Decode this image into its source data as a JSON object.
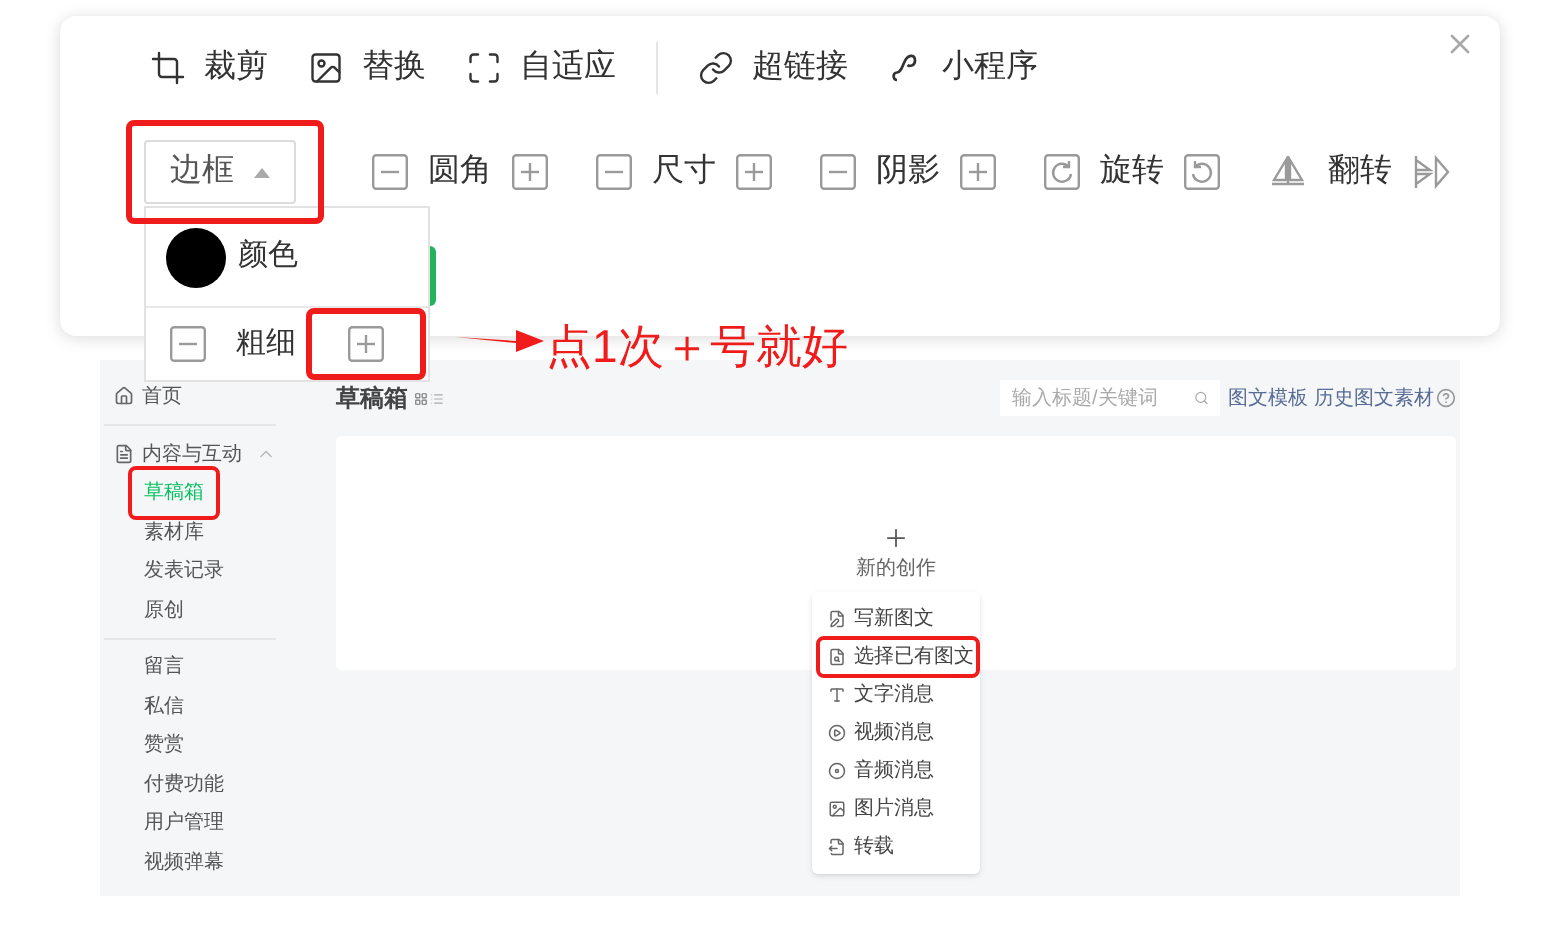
{
  "toolbar": {
    "actions": [
      {
        "kind": "crop",
        "label": "裁剪"
      },
      {
        "kind": "image",
        "label": "替换"
      },
      {
        "kind": "fit",
        "label": "自适应"
      },
      {
        "kind": "link",
        "label": "超链接"
      },
      {
        "kind": "miniprogram",
        "label": "小程序"
      }
    ],
    "controls": [
      {
        "kind": "dropdown",
        "label": "边框",
        "expanded": true,
        "highlighted": true
      },
      {
        "kind": "stepper",
        "label": "圆角",
        "highlighted": false
      },
      {
        "kind": "stepper",
        "label": "尺寸",
        "highlighted": false
      },
      {
        "kind": "stepper",
        "label": "阴影",
        "highlighted": false
      },
      {
        "kind": "rotate",
        "label": "旋转",
        "highlighted": false
      },
      {
        "kind": "flip",
        "label": "翻转",
        "highlighted": false
      }
    ]
  },
  "border_menu": {
    "items": [
      {
        "kind": "color",
        "label": "颜色",
        "color": "#000000",
        "highlighted": false
      },
      {
        "kind": "stepper",
        "label": "粗细",
        "highlighted": true
      }
    ]
  },
  "annotation": {
    "text": "点1次＋号就好"
  },
  "screenshot": {
    "sidebar": {
      "items": [
        {
          "kind": "home",
          "label": "首页"
        },
        {
          "kind": "section",
          "label": "内容与互动",
          "expanded": true,
          "children": [
            {
              "label": "草稿箱",
              "selected": true,
              "highlighted": true
            },
            {
              "label": "素材库",
              "selected": false,
              "highlighted": false
            },
            {
              "label": "发表记录",
              "selected": false,
              "highlighted": false
            },
            {
              "label": "原创",
              "selected": false,
              "highlighted": false
            }
          ]
        }
      ],
      "more_items": [
        {
          "label": "留言",
          "selected": false
        },
        {
          "label": "私信",
          "selected": false
        },
        {
          "label": "赞赏",
          "selected": false
        },
        {
          "label": "付费功能",
          "selected": false
        },
        {
          "label": "用户管理",
          "selected": false
        },
        {
          "label": "视频弹幕",
          "selected": false
        }
      ]
    },
    "title": "草稿箱",
    "search": {
      "placeholder": "输入标题/关键词"
    },
    "links": [
      "图文模板",
      "历史图文素材"
    ],
    "new_creation": {
      "label": "新的创作"
    },
    "creation_menu": [
      {
        "kind": "write",
        "label": "写新图文",
        "highlighted": false
      },
      {
        "kind": "select",
        "label": "选择已有图文",
        "highlighted": true
      },
      {
        "kind": "text",
        "label": "文字消息",
        "highlighted": false
      },
      {
        "kind": "video",
        "label": "视频消息",
        "highlighted": false
      },
      {
        "kind": "audio",
        "label": "音频消息",
        "highlighted": false
      },
      {
        "kind": "image",
        "label": "图片消息",
        "highlighted": false
      },
      {
        "kind": "repost",
        "label": "转载",
        "highlighted": false
      }
    ]
  }
}
